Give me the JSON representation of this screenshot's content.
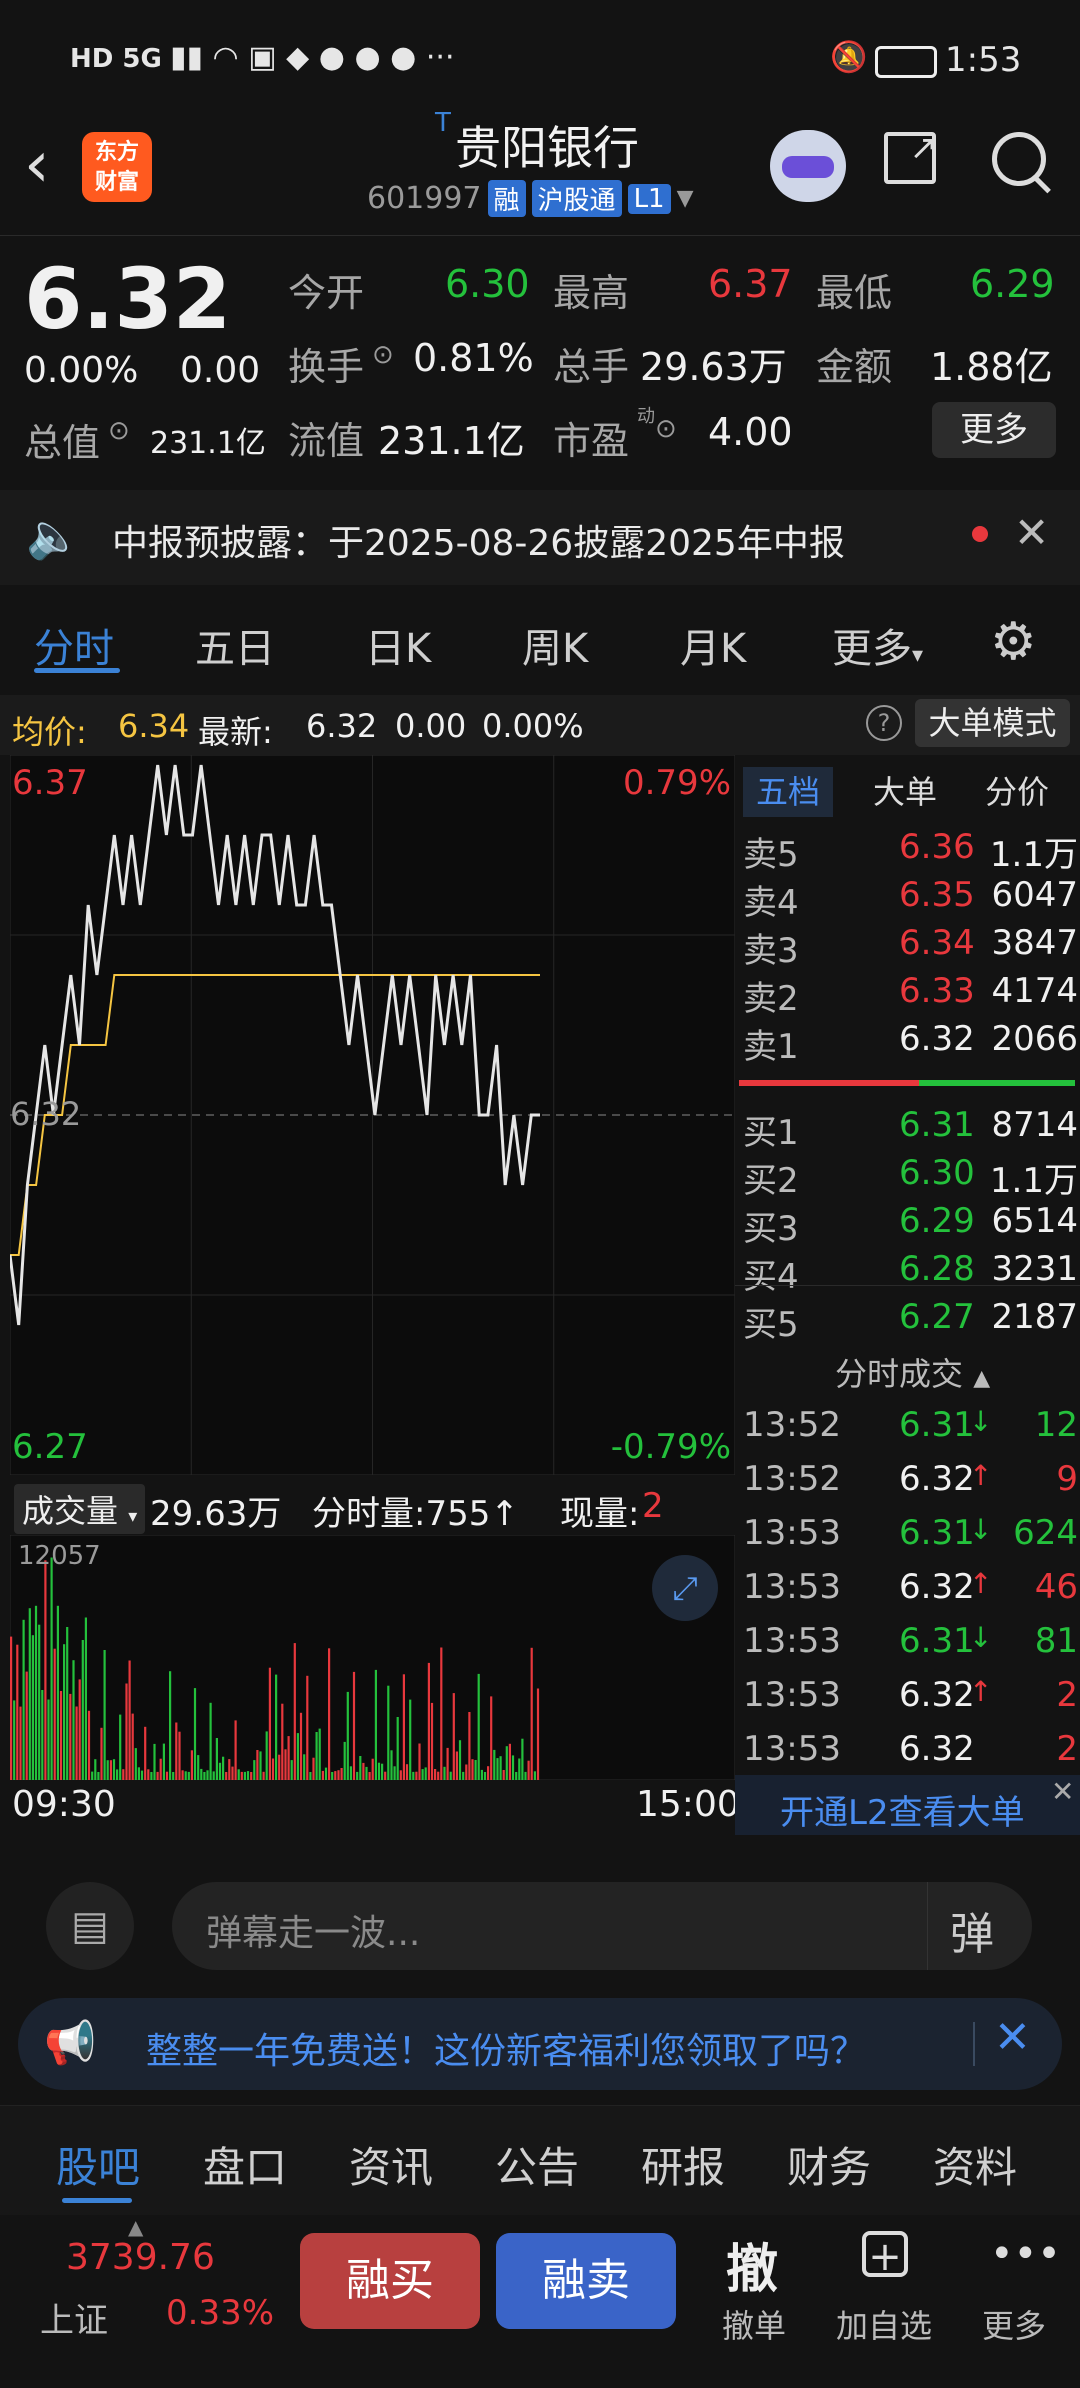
{
  "status_bar": {
    "left_icons": "HD 5G",
    "time": "1:53"
  },
  "header": {
    "logo_text_1": "东方",
    "logo_text_2": "财富",
    "title_marker": "T",
    "stock_name": "贵阳银行",
    "stock_code": "601997",
    "badge_rong": "融",
    "badge_hgt": "沪股通",
    "badge_l1": "L1"
  },
  "quote": {
    "price": "6.32",
    "change_pct": "0.00%",
    "change_val": "0.00",
    "total_value_label": "总值",
    "total_value": "231.1亿",
    "open_label": "今开",
    "open": "6.30",
    "high_label": "最高",
    "high": "6.37",
    "low_label": "最低",
    "low": "6.29",
    "turnover_label": "换手",
    "turnover": "0.81%",
    "volume_label": "总手",
    "volume": "29.63万",
    "amount_label": "金额",
    "amount": "1.88亿",
    "float_label": "流值",
    "float_value": "231.1亿",
    "pe_label": "市盈",
    "pe_sup": "动",
    "pe": "4.00",
    "more_button": "更多"
  },
  "notice": {
    "text": "中报预披露：于2025-08-26披露2025年中报"
  },
  "chart_tabs": [
    "分时",
    "五日",
    "日K",
    "周K",
    "月K",
    "更多"
  ],
  "chart_info": {
    "avg_label": "均价:",
    "avg_value": "6.34",
    "latest_label": "最新:",
    "latest_value": "6.32",
    "latest_change": "0.00",
    "latest_pct": "0.00%",
    "mode_button": "大单模式"
  },
  "chart_data": {
    "type": "line",
    "y_max_label": "6.37",
    "y_mid_label": "6.32",
    "y_min_label": "6.27",
    "pct_max_label": "0.79%",
    "pct_min_label": "-0.79%",
    "ylim": [
      6.27,
      6.37
    ],
    "x_start": "09:30",
    "x_end": "15:00",
    "series": [
      {
        "values": [
          6.3,
          6.29,
          6.31,
          6.32,
          6.33,
          6.32,
          6.33,
          6.34,
          6.33,
          6.35,
          6.34,
          6.35,
          6.36,
          6.35,
          6.36,
          6.35,
          6.36,
          6.37,
          6.36,
          6.37,
          6.36,
          6.36,
          6.37,
          6.36,
          6.35,
          6.36,
          6.35,
          6.36,
          6.35,
          6.36,
          6.36,
          6.35,
          6.36,
          6.35,
          6.35,
          6.36,
          6.35,
          6.35,
          6.34,
          6.33,
          6.34,
          6.33,
          6.32,
          6.33,
          6.34,
          6.33,
          6.34,
          6.33,
          6.32,
          6.34,
          6.33,
          6.34,
          6.33,
          6.34,
          6.32,
          6.32,
          6.33,
          6.31,
          6.32,
          6.31,
          6.32,
          6.32
        ]
      },
      {
        "name": "均价",
        "values": [
          6.3,
          6.3,
          6.31,
          6.31,
          6.32,
          6.32,
          6.32,
          6.33,
          6.33,
          6.33,
          6.33,
          6.33,
          6.34,
          6.34,
          6.34,
          6.34,
          6.34,
          6.34,
          6.34,
          6.34,
          6.34,
          6.34,
          6.34,
          6.34,
          6.34,
          6.34,
          6.34,
          6.34,
          6.34,
          6.34,
          6.34,
          6.34,
          6.34,
          6.34,
          6.34,
          6.34,
          6.34,
          6.34,
          6.34,
          6.34,
          6.34,
          6.34,
          6.34,
          6.34,
          6.34,
          6.34,
          6.34,
          6.34,
          6.34,
          6.34,
          6.34,
          6.34,
          6.34,
          6.34,
          6.34,
          6.34,
          6.34,
          6.34,
          6.34,
          6.34,
          6.34,
          6.34
        ]
      }
    ]
  },
  "volume": {
    "label": "成交量",
    "total": "29.63万",
    "tick_label": "分时量:755↑",
    "now_label": "现量:",
    "now_value": "2",
    "max_label": "12057"
  },
  "orderbook": {
    "tabs": [
      "五档",
      "大单",
      "分价"
    ],
    "asks": [
      {
        "label": "卖5",
        "price": "6.36",
        "vol": "1.1万"
      },
      {
        "label": "卖4",
        "price": "6.35",
        "vol": "6047"
      },
      {
        "label": "卖3",
        "price": "6.34",
        "vol": "3847"
      },
      {
        "label": "卖2",
        "price": "6.33",
        "vol": "4174"
      },
      {
        "label": "卖1",
        "price": "6.32",
        "vol": "2066"
      }
    ],
    "bids": [
      {
        "label": "买1",
        "price": "6.31",
        "vol": "8714"
      },
      {
        "label": "买2",
        "price": "6.30",
        "vol": "1.1万"
      },
      {
        "label": "买3",
        "price": "6.29",
        "vol": "6514"
      },
      {
        "label": "买4",
        "price": "6.28",
        "vol": "3231"
      },
      {
        "label": "买5",
        "price": "6.27",
        "vol": "2187"
      }
    ],
    "trades_title": "分时成交",
    "trades": [
      {
        "time": "13:52",
        "price": "6.31",
        "arrow": "↓",
        "vol": "12"
      },
      {
        "time": "13:52",
        "price": "6.32",
        "arrow": "↑",
        "vol": "9"
      },
      {
        "time": "13:53",
        "price": "6.31",
        "arrow": "↓",
        "vol": "624"
      },
      {
        "time": "13:53",
        "price": "6.32",
        "arrow": "↑",
        "vol": "46"
      },
      {
        "time": "13:53",
        "price": "6.31",
        "arrow": "↓",
        "vol": "81"
      },
      {
        "time": "13:53",
        "price": "6.32",
        "arrow": "↑",
        "vol": "2"
      },
      {
        "time": "13:53",
        "price": "6.32",
        "arrow": "",
        "vol": "2"
      }
    ],
    "l2_link": "开通L2查看大单"
  },
  "comment": {
    "placeholder": "弹幕走一波...",
    "danmu_label": "弹"
  },
  "promo": {
    "text": "整整一年免费送！这份新客福利您领取了吗？"
  },
  "bottom_tabs": [
    "股吧",
    "盘口",
    "资讯",
    "公告",
    "研报",
    "财务",
    "资料"
  ],
  "footer": {
    "index_value": "3739.76",
    "index_name": "上证",
    "index_pct": "0.33%",
    "buy_button": "融买",
    "sell_button": "融卖",
    "cancel_icon": "撤",
    "cancel_label": "撤单",
    "add_label": "加自选",
    "more_label": "更多"
  },
  "colors": {
    "up": "#e8383d",
    "down": "#24c13c",
    "accent": "#3b82d6",
    "avg_line": "#f5c542"
  }
}
